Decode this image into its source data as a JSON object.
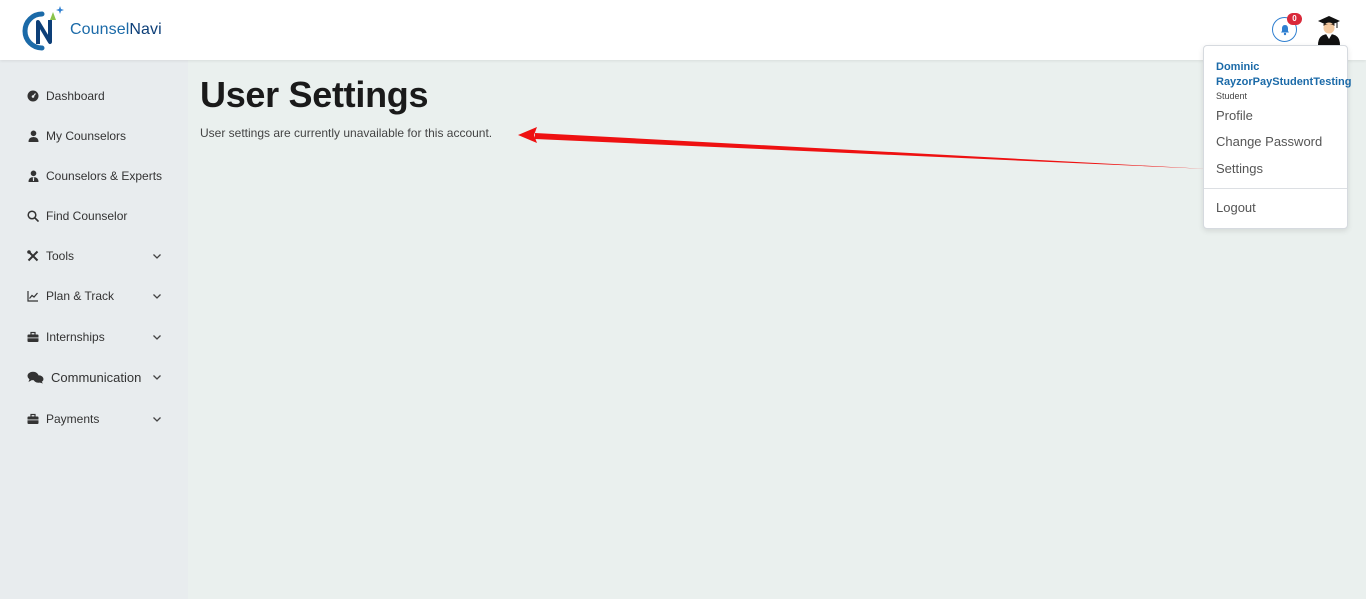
{
  "brand": {
    "name_part1": "Counsel",
    "name_part2": "Navi",
    "accent": "#1b6aa8"
  },
  "header": {
    "notification_count": "0",
    "notification_icon": "bell-icon",
    "avatar_icon": "graduate-avatar-icon"
  },
  "sidebar": {
    "items": [
      {
        "label": "Dashboard",
        "icon": "dashboard-gauge-icon",
        "has_chevron": false
      },
      {
        "label": "My Counselors",
        "icon": "user-icon",
        "has_chevron": false
      },
      {
        "label": "Counselors & Experts",
        "icon": "user-tie-icon",
        "has_chevron": false
      },
      {
        "label": "Find Counselor",
        "icon": "search-icon",
        "has_chevron": false
      },
      {
        "label": "Tools",
        "icon": "tools-icon",
        "has_chevron": true
      },
      {
        "label": "Plan & Track",
        "icon": "line-chart-icon",
        "has_chevron": true
      },
      {
        "label": "Internships",
        "icon": "briefcase-icon",
        "has_chevron": true
      },
      {
        "label": "Communication",
        "icon": "chat-bubbles-icon",
        "has_chevron": true
      },
      {
        "label": "Payments",
        "icon": "briefcase-icon",
        "has_chevron": true
      }
    ]
  },
  "main": {
    "title": "User Settings",
    "message": "User settings are currently unavailable for this account."
  },
  "user_menu": {
    "name": "Dominic RayzorPayStudentTesting",
    "role": "Student",
    "items": [
      "Profile",
      "Change Password",
      "Settings",
      "Logout"
    ]
  },
  "annotation": {
    "arrow_color": "#ee1111"
  }
}
